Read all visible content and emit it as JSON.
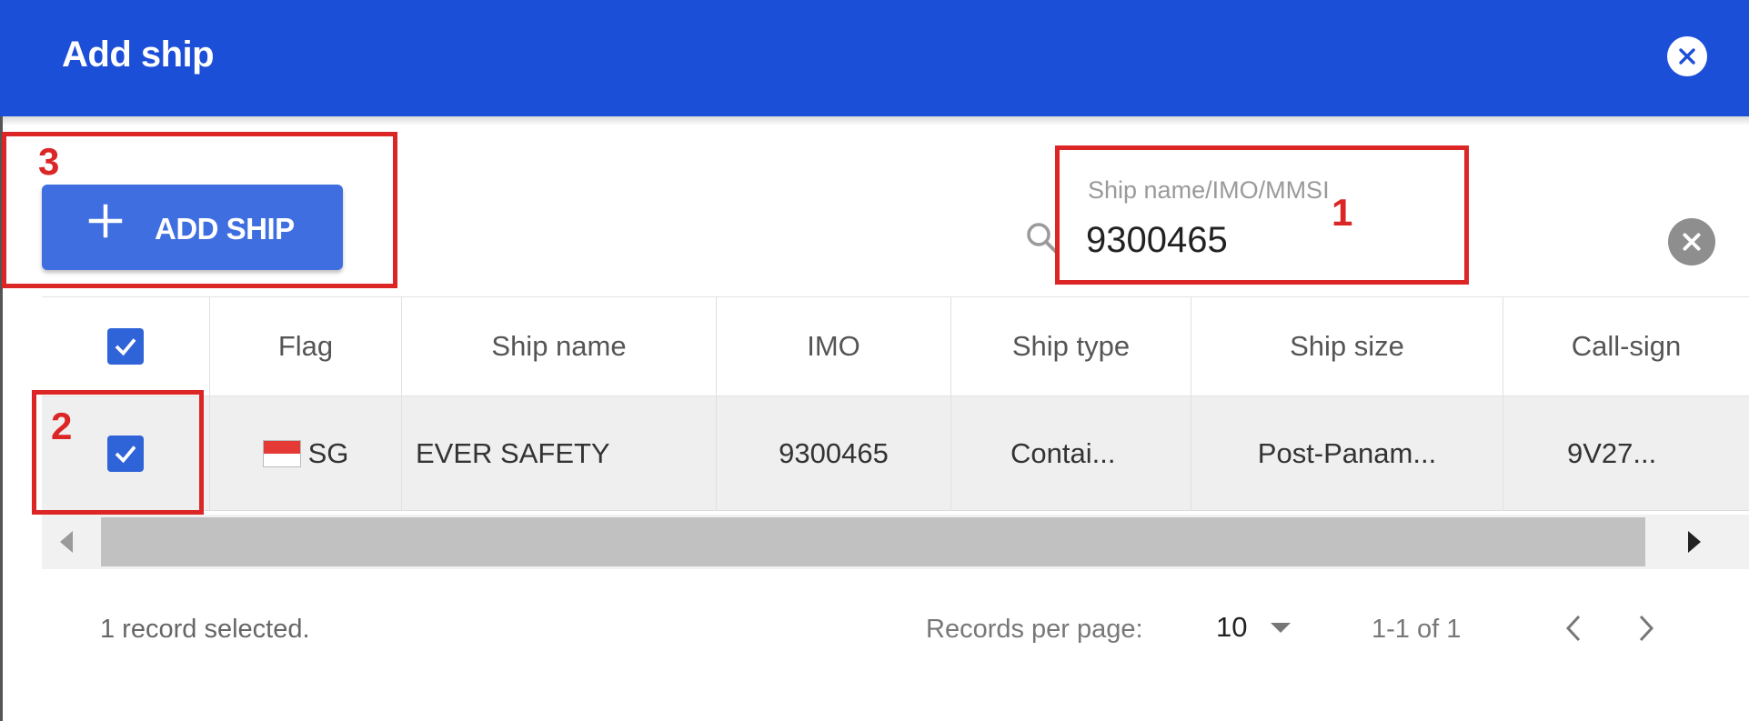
{
  "dialog": {
    "title": "Add ship"
  },
  "toolbar": {
    "add_ship_label": "ADD SHIP"
  },
  "search": {
    "label": "Ship name/IMO/MMSI",
    "value": "9300465"
  },
  "table": {
    "columns": [
      "Flag",
      "Ship name",
      "IMO",
      "Ship type",
      "Ship size",
      "Call-sign"
    ],
    "rows": [
      {
        "selected": true,
        "flag": "SG",
        "ship_name": "EVER SAFETY",
        "imo": "9300465",
        "ship_type": "Contai...",
        "ship_size": "Post-Panam...",
        "call_sign": "9V27..."
      }
    ]
  },
  "footer": {
    "selected_text": "1 record selected.",
    "records_per_page_label": "Records per page:",
    "records_per_page_value": "10",
    "range_text": "1-1 of 1"
  },
  "annotations": {
    "search_box": "1",
    "row_checkbox": "2",
    "add_ship_button": "3"
  },
  "colors": {
    "header": "#1c4fd8",
    "button": "#3f6ee0",
    "checkbox": "#2f63d8",
    "annotation": "#dc2626"
  },
  "icons": {
    "close": "close-circle-icon",
    "add": "plus-icon",
    "search": "search-icon",
    "clear": "clear-circle-icon",
    "check": "check-icon",
    "flag": "singapore-flag-icon",
    "prev": "chevron-left-icon",
    "next": "chevron-right-icon",
    "caret": "caret-down-icon"
  }
}
